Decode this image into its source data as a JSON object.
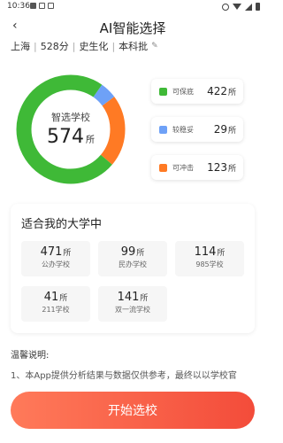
{
  "status_bar": {
    "time": "10:36"
  },
  "header": {
    "title": "AI智能选择",
    "back_icon": "chevron-left-icon"
  },
  "profile": {
    "region": "上海",
    "score": "528分",
    "subjects": "史生化",
    "batch": "本科批",
    "edit_icon": "edit-icon"
  },
  "summary": {
    "label": "智选学校",
    "count": "574",
    "unit": "所"
  },
  "chart_data": {
    "type": "pie",
    "title": "",
    "categories": [
      "可保底",
      "较稳妥",
      "可冲击"
    ],
    "values": [
      422,
      29,
      123
    ],
    "colors": [
      "#3fb937",
      "#6ea1f7",
      "#ff7a24"
    ]
  },
  "legend": [
    {
      "label": "可保底",
      "value": "422",
      "unit": "所",
      "color": "#3fb937"
    },
    {
      "label": "较稳妥",
      "value": "29",
      "unit": "所",
      "color": "#6ea1f7"
    },
    {
      "label": "可冲击",
      "value": "123",
      "unit": "所",
      "color": "#ff7a24"
    }
  ],
  "universities": {
    "title": "适合我的大学中",
    "stats": [
      {
        "value": "471",
        "unit": "所",
        "label": "公办学校"
      },
      {
        "value": "99",
        "unit": "所",
        "label": "民办学校"
      },
      {
        "value": "114",
        "unit": "所",
        "label": "985学校"
      },
      {
        "value": "41",
        "unit": "所",
        "label": "211学校"
      },
      {
        "value": "141",
        "unit": "所",
        "label": "双一流学校"
      }
    ]
  },
  "notice": {
    "title": "温馨说明:",
    "text": "1、本App提供分析结果与数据仅供参考，最终以以学校官"
  },
  "start_button": {
    "label": "开始选校"
  }
}
